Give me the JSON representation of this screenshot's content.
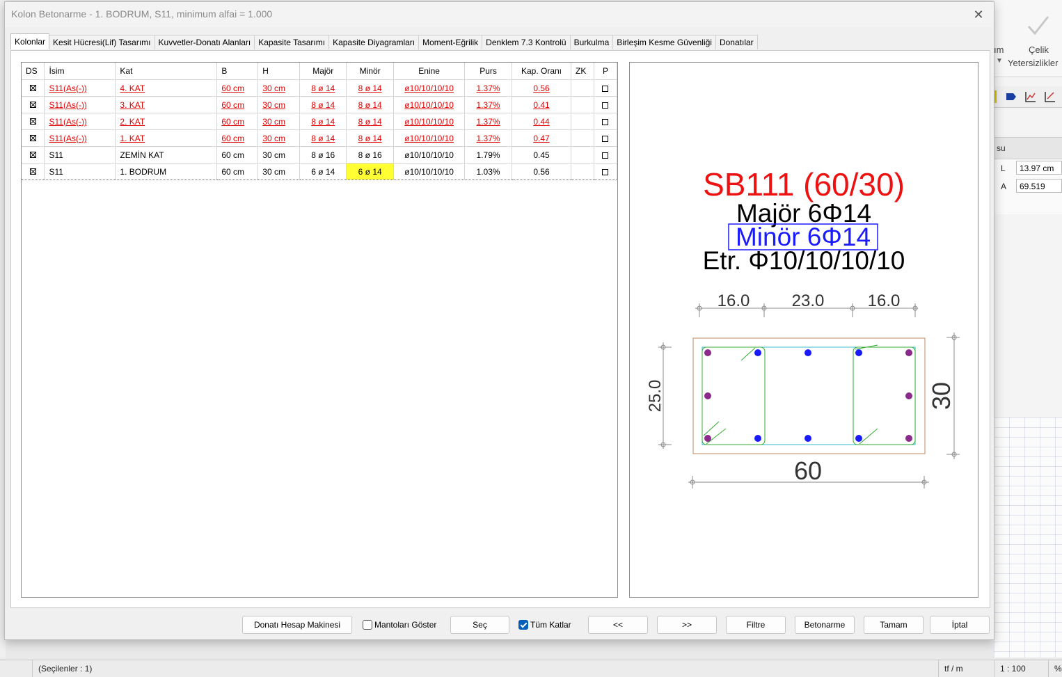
{
  "dialog": {
    "title": "Kolon Betonarme - 1. BODRUM, S11, minimum alfai = 1.000",
    "close_symbol": "✕"
  },
  "tabs": [
    {
      "label": "Kolonlar",
      "active": true
    },
    {
      "label": "Kesit Hücresi(Lif) Tasarımı"
    },
    {
      "label": "Kuvvetler-Donatı Alanları"
    },
    {
      "label": "Kapasite Tasarımı"
    },
    {
      "label": "Kapasite Diyagramları"
    },
    {
      "label": "Moment-Eğrilik"
    },
    {
      "label": "Denklem 7.3 Kontrolü"
    },
    {
      "label": "Burkulma"
    },
    {
      "label": "Birleşim Kesme Güvenliği"
    },
    {
      "label": "Donatılar"
    }
  ],
  "table": {
    "headers": [
      "DS",
      "İsim",
      "Kat",
      "B",
      "H",
      "Majör",
      "Minör",
      "Enine",
      "Purs",
      "Kap. Oranı",
      "ZK",
      "P"
    ],
    "rows": [
      {
        "isim": "S11(As(-))",
        "kat": "4. KAT",
        "b": "60 cm",
        "h": "30 cm",
        "major": "8 ø 14",
        "minor": "8 ø 14",
        "enine": "ø10/10/10/10",
        "purs": "1.37%",
        "kap": "0.56",
        "zk": "",
        "warn": true
      },
      {
        "isim": "S11(As(-))",
        "kat": "3. KAT",
        "b": "60 cm",
        "h": "30 cm",
        "major": "8 ø 14",
        "minor": "8 ø 14",
        "enine": "ø10/10/10/10",
        "purs": "1.37%",
        "kap": "0.41",
        "zk": "",
        "warn": true
      },
      {
        "isim": "S11(As(-))",
        "kat": "2. KAT",
        "b": "60 cm",
        "h": "30 cm",
        "major": "8 ø 14",
        "minor": "8 ø 14",
        "enine": "ø10/10/10/10",
        "purs": "1.37%",
        "kap": "0.44",
        "zk": "",
        "warn": true
      },
      {
        "isim": "S11(As(-))",
        "kat": "1. KAT",
        "b": "60 cm",
        "h": "30 cm",
        "major": "8 ø 14",
        "minor": "8 ø 14",
        "enine": "ø10/10/10/10",
        "purs": "1.37%",
        "kap": "0.47",
        "zk": "",
        "warn": true
      },
      {
        "isim": "S11",
        "kat": "ZEMİN KAT",
        "b": "60 cm",
        "h": "30 cm",
        "major": "8 ø 16",
        "minor": "8 ø 16",
        "enine": "ø10/10/10/10",
        "purs": "1.79%",
        "kap": "0.45",
        "zk": "",
        "warn": false
      },
      {
        "isim": "S11",
        "kat": "1. BODRUM",
        "b": "60 cm",
        "h": "30 cm",
        "major": "6 ø 14",
        "minor": "6 ø 14",
        "enine": "ø10/10/10/10",
        "purs": "1.03%",
        "kap": "0.56",
        "zk": "",
        "warn": false,
        "selected": true
      }
    ]
  },
  "drawing": {
    "name": "SB111 (60/30)",
    "major": "Majör 6Φ14",
    "minor": "Minör 6Φ14",
    "stirrup": "Etr. Φ10/10/10/10",
    "dim_top": [
      "16.0",
      "23.0",
      "16.0"
    ],
    "dim_left": "25.0",
    "dim_right": "30",
    "dim_bottom": "60",
    "colors": {
      "title": "#ee1111",
      "minor": "#1a1aff",
      "corner_bar": "#8b2a8b",
      "bar": "#1a1aff",
      "stirrup": "#33aa33",
      "tie": "#33bbcc",
      "concrete": "#c08a60"
    }
  },
  "buttons": {
    "calc": "Donatı Hesap Makinesi",
    "show_jackets": "Mantoları Göster",
    "select": "Seç",
    "all_floors": "Tüm Katlar",
    "prev": "<<",
    "next": ">>",
    "filter": "Filtre",
    "concrete": "Betonarme",
    "ok": "Tamam",
    "cancel": "İptal"
  },
  "checks": {
    "show_jackets": false,
    "all_floors": true
  },
  "background_app": {
    "ribbon_partial": "ım",
    "ribbon_label1": "Çelik",
    "ribbon_label2": "Yetersizlikler",
    "panel_title": "su",
    "prop_L": "L",
    "val_L": "13.97 cm",
    "prop_A": "A",
    "val_A": "69.519"
  },
  "status": {
    "selected": "(Seçilenler : 1)",
    "units": "tf / m",
    "scale": "1 : 100",
    "percent": "%"
  }
}
